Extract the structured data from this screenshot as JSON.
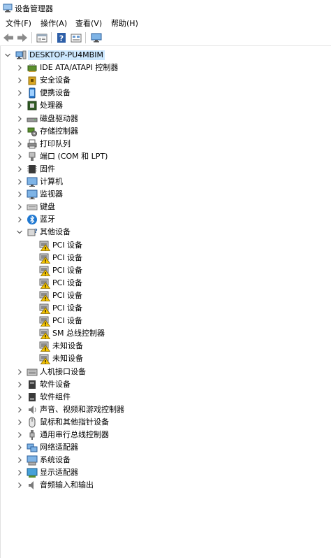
{
  "window": {
    "title": "设备管理器"
  },
  "menu": [
    {
      "label": "文件(F)"
    },
    {
      "label": "操作(A)"
    },
    {
      "label": "查看(V)"
    },
    {
      "label": "帮助(H)"
    }
  ],
  "toolbar": [
    {
      "icon": "back-arrow-icon"
    },
    {
      "icon": "forward-arrow-icon"
    },
    {
      "icon": "properties-icon"
    },
    {
      "icon": "help-icon"
    },
    {
      "icon": "update-driver-icon"
    },
    {
      "icon": "monitor-scan-icon"
    }
  ],
  "tree": {
    "root": {
      "label": "DESKTOP-PU4MBIM",
      "expanded": true,
      "icon": "computer-icon"
    },
    "categories": [
      {
        "label": "IDE ATA/ATAPI 控制器",
        "icon": "ide-controller-icon",
        "expanded": false
      },
      {
        "label": "安全设备",
        "icon": "security-device-icon",
        "expanded": false
      },
      {
        "label": "便携设备",
        "icon": "portable-device-icon",
        "expanded": false
      },
      {
        "label": "处理器",
        "icon": "processor-icon",
        "expanded": false
      },
      {
        "label": "磁盘驱动器",
        "icon": "disk-drive-icon",
        "expanded": false
      },
      {
        "label": "存储控制器",
        "icon": "storage-controller-icon",
        "expanded": false
      },
      {
        "label": "打印队列",
        "icon": "printer-icon",
        "expanded": false
      },
      {
        "label": "端口 (COM 和 LPT)",
        "icon": "port-icon",
        "expanded": false
      },
      {
        "label": "固件",
        "icon": "firmware-icon",
        "expanded": false
      },
      {
        "label": "计算机",
        "icon": "monitor-icon",
        "expanded": false
      },
      {
        "label": "监视器",
        "icon": "monitor-icon",
        "expanded": false
      },
      {
        "label": "键盘",
        "icon": "keyboard-icon",
        "expanded": false
      },
      {
        "label": "蓝牙",
        "icon": "bluetooth-icon",
        "expanded": false
      },
      {
        "label": "其他设备",
        "icon": "unknown-device-icon",
        "expanded": true,
        "children": [
          {
            "label": "PCI 设备",
            "icon": "warning-device-icon"
          },
          {
            "label": "PCI 设备",
            "icon": "warning-device-icon"
          },
          {
            "label": "PCI 设备",
            "icon": "warning-device-icon"
          },
          {
            "label": "PCI 设备",
            "icon": "warning-device-icon"
          },
          {
            "label": "PCI 设备",
            "icon": "warning-device-icon"
          },
          {
            "label": "PCI 设备",
            "icon": "warning-device-icon"
          },
          {
            "label": "PCI 设备",
            "icon": "warning-device-icon"
          },
          {
            "label": "SM 总线控制器",
            "icon": "warning-device-icon"
          },
          {
            "label": "未知设备",
            "icon": "warning-device-icon"
          },
          {
            "label": "未知设备",
            "icon": "warning-device-icon"
          }
        ]
      },
      {
        "label": "人机接口设备",
        "icon": "hid-icon",
        "expanded": false
      },
      {
        "label": "软件设备",
        "icon": "software-device-icon",
        "expanded": false
      },
      {
        "label": "软件组件",
        "icon": "software-component-icon",
        "expanded": false
      },
      {
        "label": "声音、视频和游戏控制器",
        "icon": "speaker-icon",
        "expanded": false
      },
      {
        "label": "鼠标和其他指针设备",
        "icon": "mouse-icon",
        "expanded": false
      },
      {
        "label": "通用串行总线控制器",
        "icon": "usb-icon",
        "expanded": false
      },
      {
        "label": "网络适配器",
        "icon": "network-adapter-icon",
        "expanded": false
      },
      {
        "label": "系统设备",
        "icon": "system-device-icon",
        "expanded": false
      },
      {
        "label": "显示适配器",
        "icon": "display-adapter-icon",
        "expanded": false
      },
      {
        "label": "音频输入和输出",
        "icon": "audio-io-icon",
        "expanded": false
      }
    ]
  },
  "colors": {
    "selection": "#cce8ff",
    "warning": "#f5c400",
    "accent": "#2b7cd3"
  }
}
